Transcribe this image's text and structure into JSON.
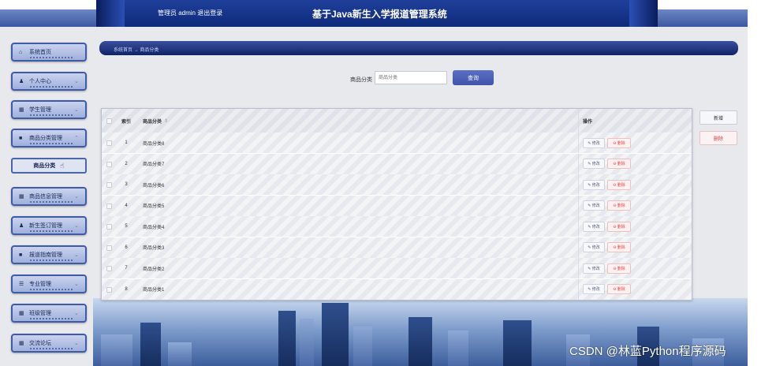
{
  "header": {
    "user_text": "管理员 admin  退出登录",
    "title": "基于Java新生入学报道管理系统"
  },
  "sidebar": {
    "items": [
      {
        "label": "系统首页",
        "icon": "home-icon"
      },
      {
        "label": "个人中心",
        "icon": "person-icon"
      },
      {
        "label": "学生管理",
        "icon": "grid-icon"
      },
      {
        "label": "商品分类管理",
        "icon": "box-icon"
      },
      {
        "label": "商品分类",
        "icon": ""
      },
      {
        "label": "商品信息管理",
        "icon": "grid-icon"
      },
      {
        "label": "新生签订管理",
        "icon": "person-icon"
      },
      {
        "label": "报道指南管理",
        "icon": "box-icon"
      },
      {
        "label": "专业管理",
        "icon": "list-icon"
      },
      {
        "label": "班级管理",
        "icon": "grid-icon"
      },
      {
        "label": "交流论坛",
        "icon": "grid-icon"
      }
    ]
  },
  "breadcrumb": "系统首页 → 商品分类",
  "search": {
    "label": "商品分类",
    "placeholder": "商品分类",
    "button": "查询"
  },
  "actions": {
    "add": "新增",
    "delete": "删除"
  },
  "table": {
    "headers": {
      "index": "索引",
      "name": "商品分类",
      "ops": "操作"
    },
    "edit_label": "✎ 修改",
    "delete_label": "⊖ 删除",
    "rows": [
      {
        "index": "1",
        "name": "商品分类8"
      },
      {
        "index": "2",
        "name": "商品分类7"
      },
      {
        "index": "3",
        "name": "商品分类6"
      },
      {
        "index": "4",
        "name": "商品分类5"
      },
      {
        "index": "5",
        "name": "商品分类4"
      },
      {
        "index": "6",
        "name": "商品分类3"
      },
      {
        "index": "7",
        "name": "商品分类2"
      },
      {
        "index": "8",
        "name": "商品分类1"
      }
    ]
  },
  "watermark": "CSDN @林蓝Python程序源码"
}
